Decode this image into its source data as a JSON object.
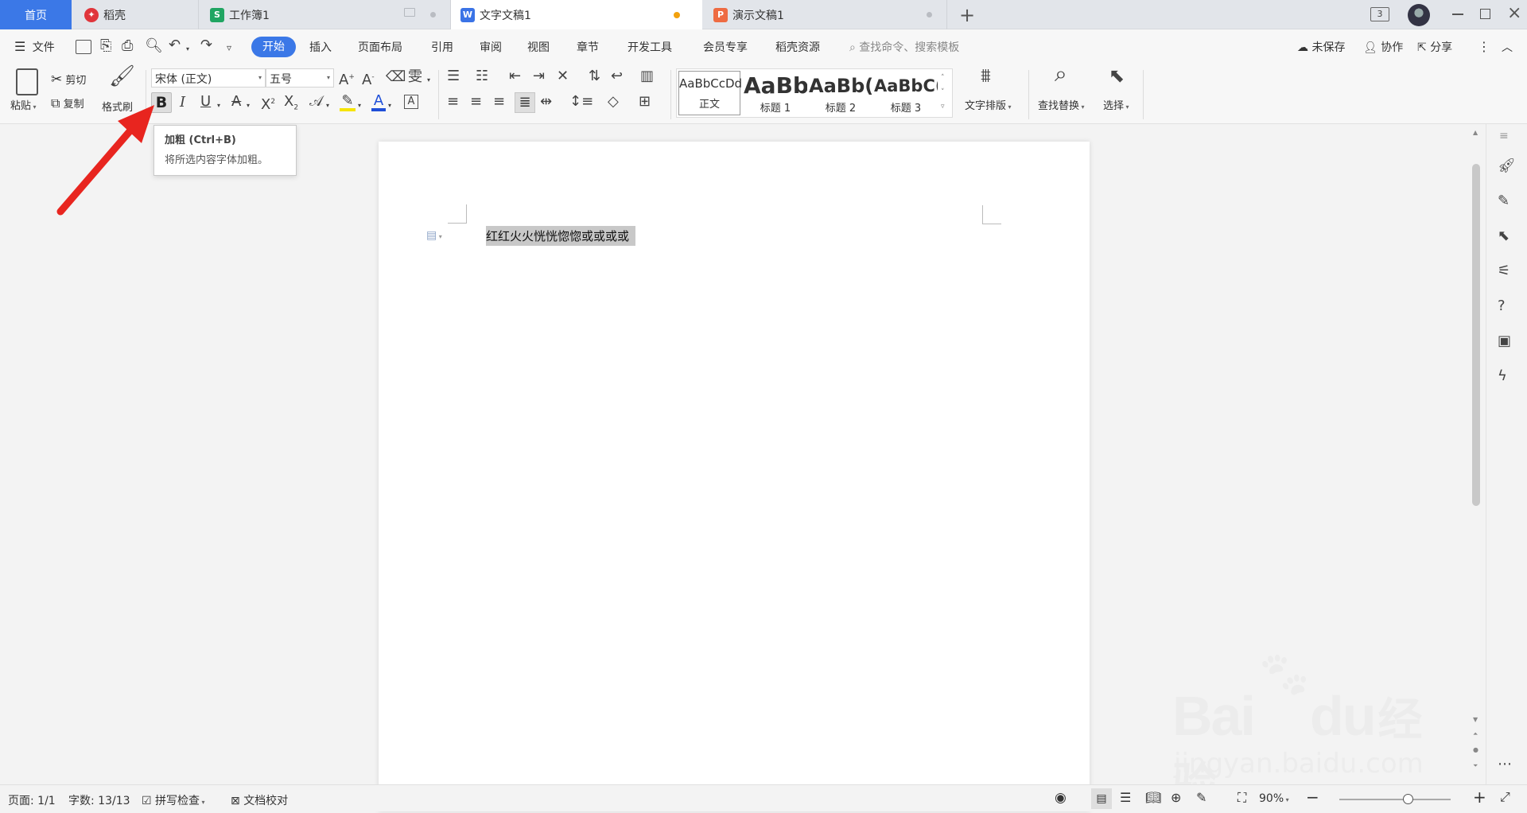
{
  "tabs": [
    {
      "label": "首页",
      "active": false,
      "home": true
    },
    {
      "label": "稻壳",
      "icon": "daoke-icon",
      "color": "#e0353b"
    },
    {
      "label": "工作簿1",
      "icon": "spreadsheet-icon",
      "glyph": "S",
      "color": "#20a562"
    },
    {
      "label": "文字文稿1",
      "icon": "writer-icon",
      "glyph": "W",
      "color": "#3a73e6",
      "active": true
    },
    {
      "label": "演示文稿1",
      "icon": "presentation-icon",
      "glyph": "P",
      "color": "#ee6b42"
    }
  ],
  "window": {
    "tab_count": "3"
  },
  "menu": {
    "file": "文件",
    "items": [
      "开始",
      "插入",
      "页面布局",
      "引用",
      "审阅",
      "视图",
      "章节",
      "开发工具",
      "会员专享",
      "稻壳资源"
    ],
    "active": "开始",
    "search_placeholder": "查找命令、搜索模板",
    "unsaved": "未保存",
    "collab": "协作",
    "share": "分享"
  },
  "ribbon": {
    "paste": "粘贴",
    "cut": "剪切",
    "copy": "复制",
    "format_painter": "格式刷",
    "font_name": "宋体 (正文)",
    "font_size": "五号",
    "styles": [
      {
        "preview": "AaBbCcDd",
        "label": "正文"
      },
      {
        "preview": "AaBb",
        "label": "标题 1"
      },
      {
        "preview": "AaBb(",
        "label": "标题 2"
      },
      {
        "preview": "AaBbC(",
        "label": "标题 3"
      }
    ],
    "text_layout": "文字排版",
    "find_replace": "查找替换",
    "select": "选择"
  },
  "tooltip": {
    "title": "加粗 (Ctrl+B)",
    "desc": "将所选内容字体加粗。"
  },
  "document": {
    "text": "红红火火恍恍惚惚或或或或"
  },
  "status": {
    "page": "页面: 1/1",
    "words": "字数: 13/13",
    "spell": "拼写检查",
    "proof": "文档校对",
    "zoom": "90%",
    "zoom_fraction": 0.62
  },
  "watermark": {
    "brand": "Bai",
    "brand2": "du",
    "suffix": "经验",
    "url": "jingyan.baidu.com"
  },
  "colors": {
    "accent": "#3b78e7",
    "highlight": "#c8c8c8",
    "arrow": "#e8251f"
  }
}
